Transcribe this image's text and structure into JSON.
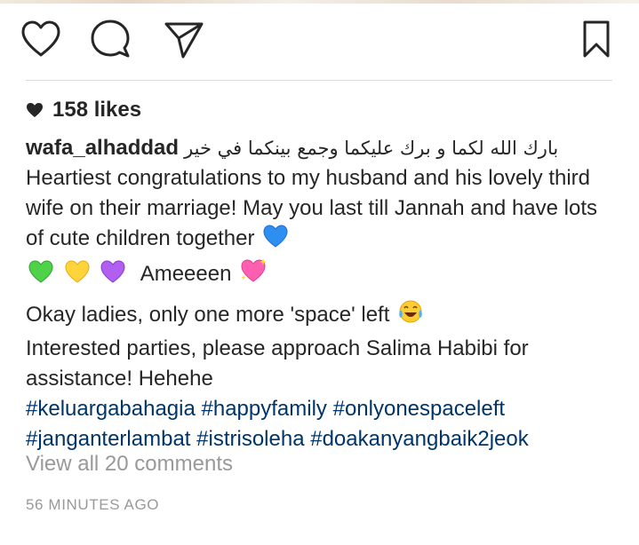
{
  "actions": {
    "like_icon": "heart-outline",
    "comment_icon": "speech-bubble",
    "share_icon": "paper-plane",
    "save_icon": "bookmark"
  },
  "likes": {
    "count_label": "158 likes"
  },
  "post": {
    "username": "wafa_alhaddad",
    "arabic_text": "بارك الله لكما و برك عليكما وجمع بينكما في خير",
    "line1": "Heartiest congratulations to my husband and his lovely third wife on their marriage! May you last till Jannah and have lots of cute children together",
    "line2": "Ameeeen",
    "line3": "Okay ladies, only one more 'space' left",
    "line4": "Interested parties, please approach Salima Habibi for assistance! Hehehe",
    "hashtags": [
      "#keluargabahagia",
      "#happyfamily",
      "#onlyonespaceleft",
      "#janganterlambat",
      "#istrisoleha",
      "#doakanyangbaik2jeok"
    ]
  },
  "comments": {
    "view_all_label": "View all 20 comments"
  },
  "timestamp": "56 MINUTES AGO",
  "colors": {
    "text": "#262626",
    "hashtag": "#003569",
    "muted": "#999999",
    "divider": "#dbdbdb"
  }
}
